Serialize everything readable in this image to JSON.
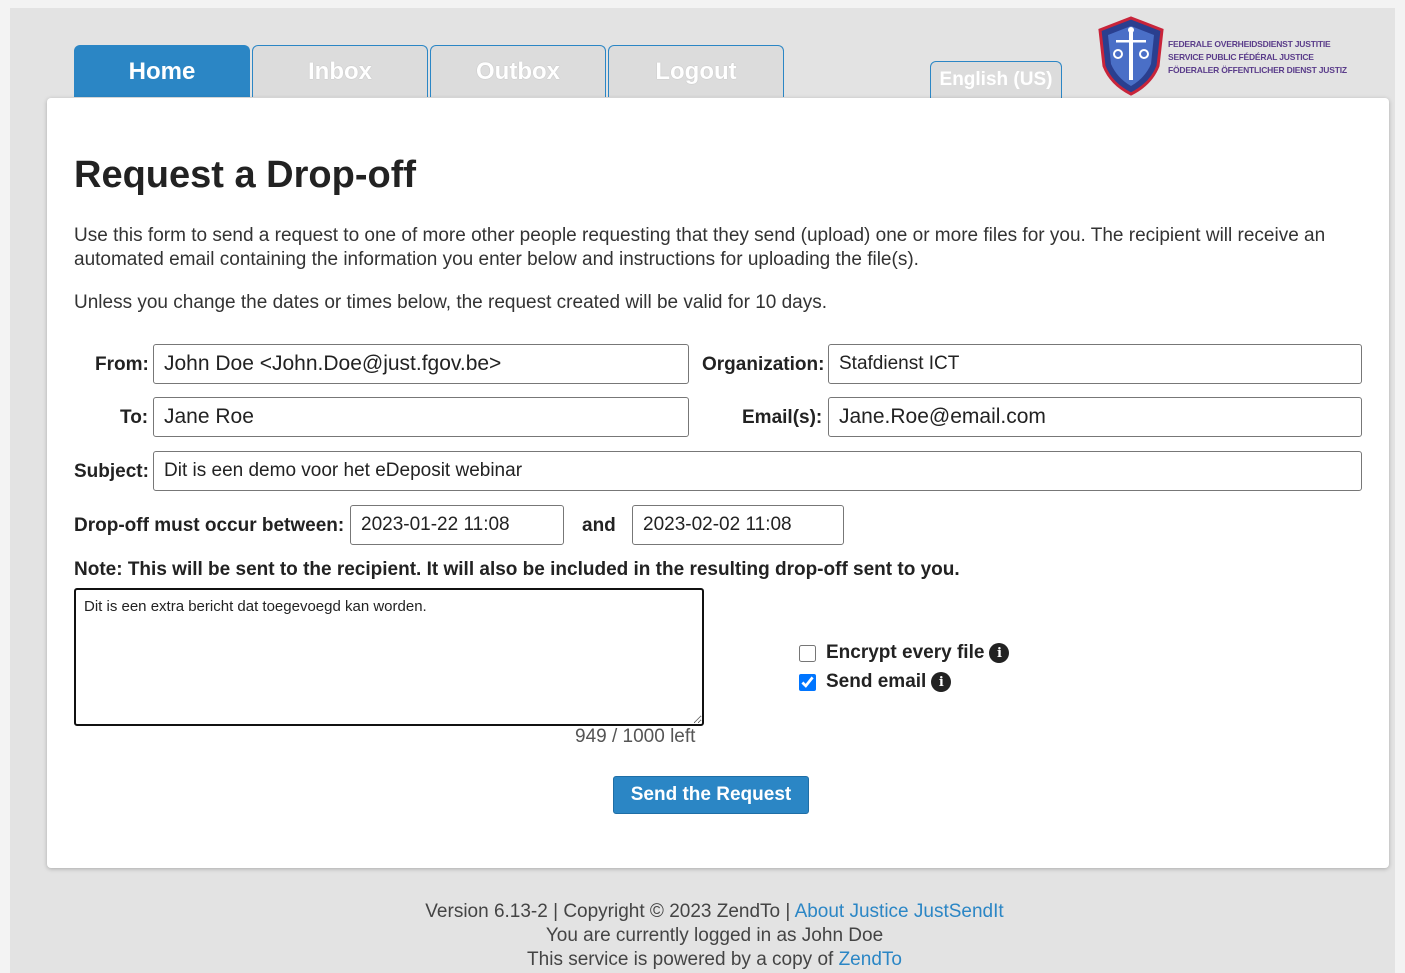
{
  "nav": {
    "tabs": [
      {
        "label": "Home",
        "active": true
      },
      {
        "label": "Inbox",
        "active": false
      },
      {
        "label": "Outbox",
        "active": false
      },
      {
        "label": "Logout",
        "active": false
      }
    ],
    "language": "English (US)"
  },
  "logo": {
    "lines": [
      "FEDERALE OVERHEIDSDIENST JUSTITIE",
      "SERVICE PUBLIC FÉDÉRAL JUSTICE",
      "FÖDERALER ÖFFENTLICHER DIENST JUSTIZ"
    ]
  },
  "page": {
    "title": "Request a Drop-off",
    "intro": "Use this form to send a request to one of more other people requesting that they send (upload) one or more files for you. The recipient will receive an automated email containing the information you enter below and instructions for uploading the file(s).",
    "validity": "Unless you change the dates or times below, the request created will be valid for 10 days."
  },
  "form": {
    "from_label": "From:",
    "from_value": "John Doe <John.Doe@just.fgov.be>",
    "org_label": "Organization:",
    "org_value": "Stafdienst ICT",
    "to_label": "To:",
    "to_value": "Jane Roe",
    "email_label": "Email(s):",
    "email_value": "Jane.Roe@email.com",
    "subject_label": "Subject:",
    "subject_value": "Dit is een demo voor het eDeposit webinar",
    "between_label": "Drop-off must occur between:",
    "start_value": "2023-01-22 11:08",
    "and_label": "and",
    "end_value": "2023-02-02 11:08",
    "note_label": "Note: This will be sent to the recipient. It will also be included in the resulting drop-off sent to you.",
    "note_value": "Dit is een extra bericht dat toegevoegd kan worden.",
    "counter": "949 / 1000 left",
    "encrypt_label": "Encrypt every file",
    "encrypt_checked": false,
    "sendemail_label": "Send email",
    "sendemail_checked": true,
    "submit_label": "Send the Request"
  },
  "footer": {
    "version": "Version 6.13-2 | Copyright © 2023 ZendTo | ",
    "about_link": "About Justice JustSendIt",
    "logged_in": "You are currently logged in as John Doe",
    "powered_prefix": "This service is powered by a copy of ",
    "powered_link": "ZendTo"
  },
  "colors": {
    "accent": "#2b86c5"
  }
}
